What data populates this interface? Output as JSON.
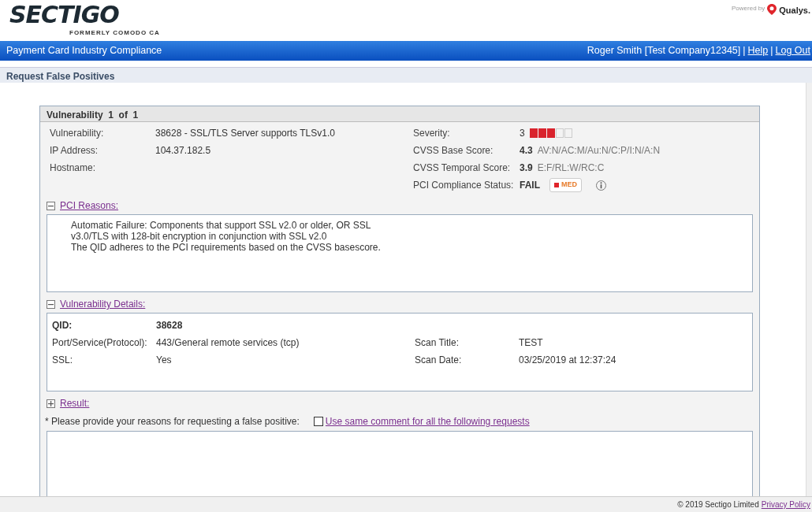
{
  "header": {
    "logo": "SECTIGO",
    "logo_tagline": "FORMERLY COMODO CA",
    "powered_by": "Powered by",
    "partner": "Qualys."
  },
  "nav": {
    "title": "Payment Card Industry Compliance",
    "user": "Roger Smith [Test Company12345]",
    "separator": "|",
    "links": [
      "Help",
      "Log Out"
    ]
  },
  "page_title": "Request False Positives",
  "panel": {
    "title": "Vulnerability  1  of  1",
    "left_fields": [
      {
        "label": "Vulnerability:",
        "value": "38628 - SSL/TLS Server supports TLSv1.0"
      },
      {
        "label": "IP Address:",
        "value": "104.37.182.5"
      },
      {
        "label": "Hostname:"
      }
    ],
    "severity": {
      "label": "Severity:",
      "value": "3",
      "level": 0.6
    },
    "cvss_base": {
      "label": "CVSS Base Score:",
      "score": "4.3",
      "vector": "AV:N/AC:M/Au:N/C:P/I:N/A:N"
    },
    "cvss_temporal": {
      "label": "CVSS Temporal Score:",
      "score": "3.9",
      "vector": "E:F/RL:W/RC:C"
    },
    "pci_status": {
      "label": "PCI Compliance Status:",
      "value": "FAIL",
      "badge": "MED",
      "color": "#e0252b"
    },
    "sections": [
      {
        "kind": "reasons",
        "title": "PCI Reasons:",
        "expanded": true,
        "lines": [
          "Automatic Failure: Components that support SSL v2.0 or older, OR SSL",
          "v3.0/TLS with 128-bit encryption in conjunction with SSL v2.0",
          "The QID adheres to the PCI requirements based on the CVSS basescore."
        ]
      },
      {
        "kind": "details",
        "title": "Vulnerability Details:",
        "expanded": true,
        "rows": [
          [
            {
              "label": "QID:",
              "value": "38628",
              "bold": true
            }
          ],
          [
            {
              "label": "Port/Service(Protocol):",
              "value": "443/General remote services (tcp)",
              "bold": false
            },
            {
              "label": "Scan Title:",
              "value": "TEST",
              "bold": false
            }
          ],
          [
            {
              "label": "SSL:",
              "value": "Yes",
              "bold": false
            },
            {
              "label": "Scan Date:",
              "value": "03/25/2019 at 12:37:24",
              "bold": false
            }
          ]
        ]
      },
      {
        "kind": "result",
        "title": "Result:",
        "expanded": false
      }
    ],
    "prompt": "* Please provide your reasons for requesting a false positive:",
    "same_comment": {
      "label": "Use same comment for all the following requests",
      "checked": false
    }
  },
  "footer": {
    "copyright": "© 2019 Sectigo Limited",
    "link": "Privacy Policy"
  }
}
